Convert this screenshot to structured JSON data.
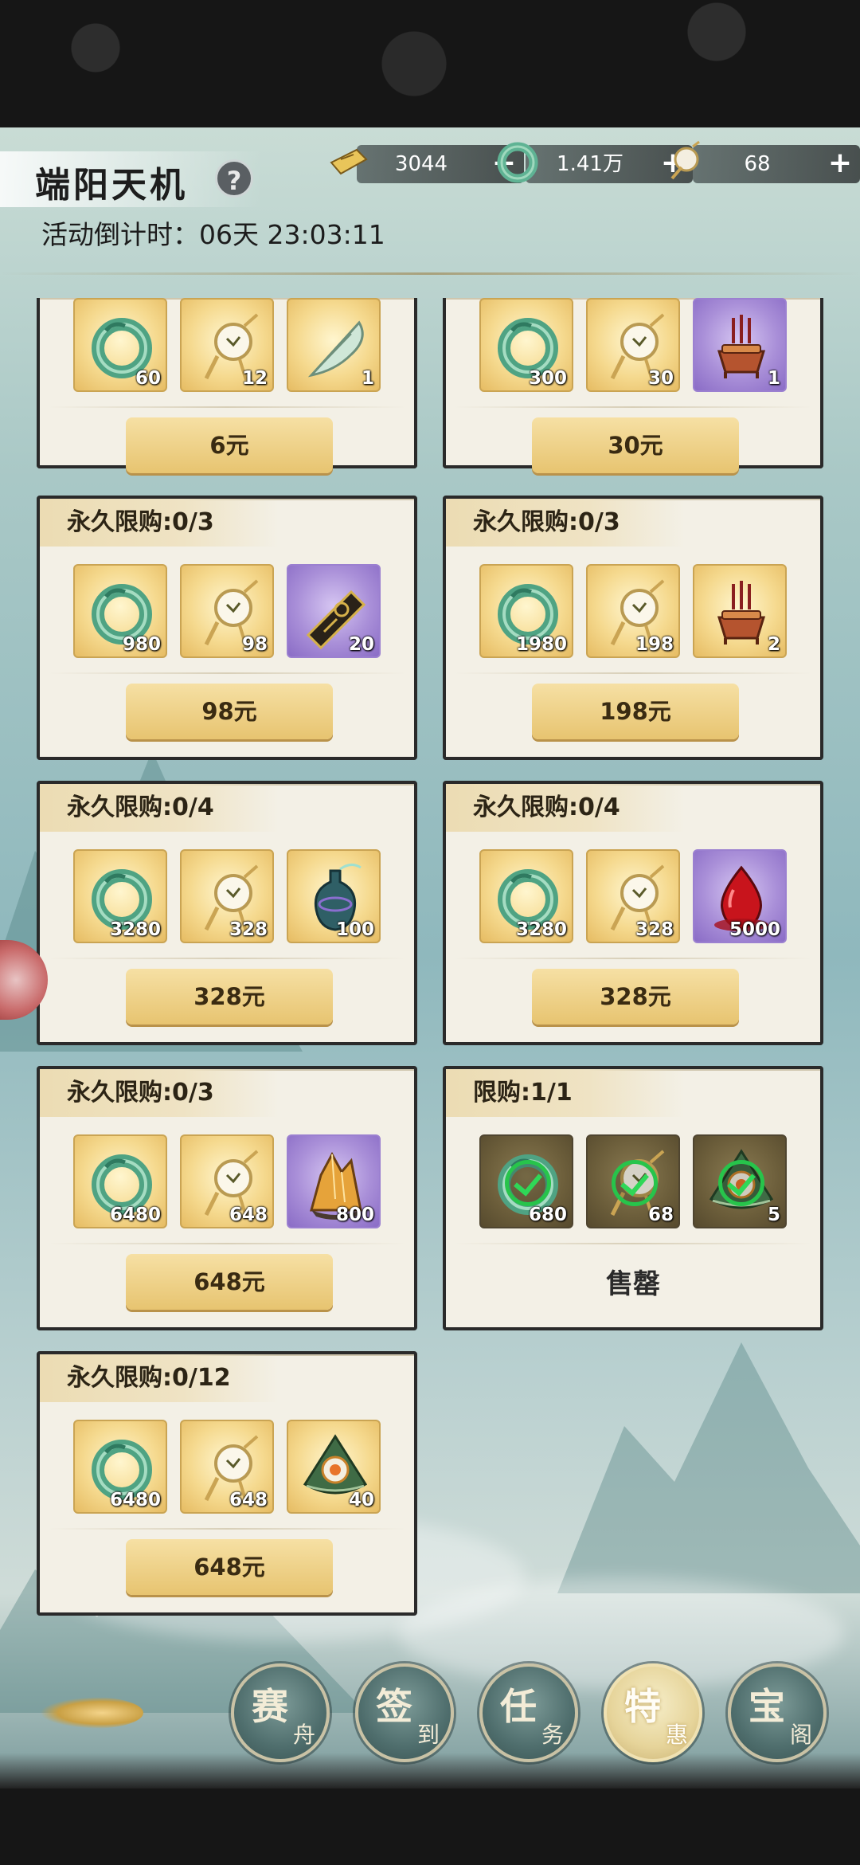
{
  "header": {
    "title": "端阳天机",
    "help_label": "?",
    "countdown": "活动倒计时：06天 23:03:11"
  },
  "resources": [
    {
      "icon": "ticket-icon",
      "value": "3044",
      "add": "+"
    },
    {
      "icon": "jade-ring-icon",
      "value": "1.41万",
      "add": "+"
    },
    {
      "icon": "pouch-icon",
      "value": "68",
      "add": "+"
    }
  ],
  "packs": [
    {
      "limit": "",
      "items": [
        {
          "icon": "jade-ring-icon",
          "qty": "60",
          "bg": "gold"
        },
        {
          "icon": "pouch-icon",
          "qty": "12",
          "bg": "gold"
        },
        {
          "icon": "feather-fan-icon",
          "qty": "1",
          "bg": "gold"
        }
      ],
      "price": "6元"
    },
    {
      "limit": "",
      "items": [
        {
          "icon": "jade-ring-icon",
          "qty": "300",
          "bg": "gold"
        },
        {
          "icon": "pouch-icon",
          "qty": "30",
          "bg": "gold"
        },
        {
          "icon": "incense-burner-icon",
          "qty": "1",
          "bg": "purple"
        }
      ],
      "price": "30元"
    },
    {
      "limit": "永久限购:0/3",
      "items": [
        {
          "icon": "jade-ring-icon",
          "qty": "980",
          "bg": "gold"
        },
        {
          "icon": "pouch-icon",
          "qty": "98",
          "bg": "gold"
        },
        {
          "icon": "token-plate-icon",
          "qty": "20",
          "bg": "purple"
        }
      ],
      "price": "98元"
    },
    {
      "limit": "永久限购:0/3",
      "items": [
        {
          "icon": "jade-ring-icon",
          "qty": "1980",
          "bg": "gold"
        },
        {
          "icon": "pouch-icon",
          "qty": "198",
          "bg": "gold"
        },
        {
          "icon": "incense-burner-icon",
          "qty": "2",
          "bg": "gold"
        }
      ],
      "price": "198元"
    },
    {
      "limit": "永久限购:0/4",
      "items": [
        {
          "icon": "jade-ring-icon",
          "qty": "3280",
          "bg": "gold"
        },
        {
          "icon": "pouch-icon",
          "qty": "328",
          "bg": "gold"
        },
        {
          "icon": "vase-icon",
          "qty": "100",
          "bg": "gold"
        }
      ],
      "price": "328元"
    },
    {
      "limit": "永久限购:0/4",
      "items": [
        {
          "icon": "jade-ring-icon",
          "qty": "3280",
          "bg": "gold"
        },
        {
          "icon": "pouch-icon",
          "qty": "328",
          "bg": "gold"
        },
        {
          "icon": "blood-drop-icon",
          "qty": "5000",
          "bg": "purple"
        }
      ],
      "price": "328元"
    },
    {
      "limit": "永久限购:0/3",
      "items": [
        {
          "icon": "jade-ring-icon",
          "qty": "6480",
          "bg": "gold"
        },
        {
          "icon": "pouch-icon",
          "qty": "648",
          "bg": "gold"
        },
        {
          "icon": "crystal-ore-icon",
          "qty": "800",
          "bg": "purple"
        }
      ],
      "price": "648元"
    },
    {
      "limit": "限购:1/1",
      "items": [
        {
          "icon": "jade-ring-icon",
          "qty": "680",
          "bg": "dark"
        },
        {
          "icon": "pouch-icon",
          "qty": "68",
          "bg": "dark"
        },
        {
          "icon": "zongzi-icon",
          "qty": "5",
          "bg": "dark"
        }
      ],
      "price": "售罄",
      "sold_out": true
    },
    {
      "limit": "永久限购:0/12",
      "items": [
        {
          "icon": "jade-ring-icon",
          "qty": "6480",
          "bg": "gold"
        },
        {
          "icon": "pouch-icon",
          "qty": "648",
          "bg": "gold"
        },
        {
          "icon": "zongzi-icon",
          "qty": "40",
          "bg": "gold"
        }
      ],
      "price": "648元"
    }
  ],
  "nav": [
    {
      "main": "赛",
      "sub": "舟",
      "active": false
    },
    {
      "main": "签",
      "sub": "到",
      "active": false
    },
    {
      "main": "任",
      "sub": "务",
      "active": false
    },
    {
      "main": "特",
      "sub": "惠",
      "active": true
    },
    {
      "main": "宝",
      "sub": "阁",
      "active": false
    }
  ]
}
